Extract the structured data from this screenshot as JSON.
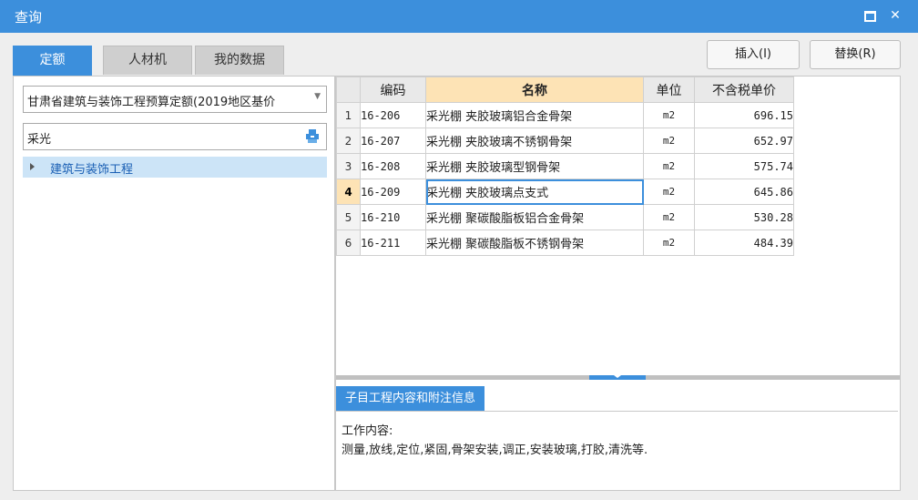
{
  "window": {
    "title": "查询"
  },
  "tabs": [
    {
      "label": "定额",
      "active": true
    },
    {
      "label": "人材机",
      "active": false
    },
    {
      "label": "我的数据",
      "active": false
    }
  ],
  "buttons": {
    "insert": "插入(I)",
    "replace": "替换(R)"
  },
  "left": {
    "selected_quota": "甘肃省建筑与装饰工程预算定额(2019地区基价",
    "search_value": "采光",
    "tree": [
      {
        "label": "建筑与装饰工程"
      }
    ]
  },
  "table": {
    "headers": [
      "编码",
      "名称",
      "单位",
      "不含税单价"
    ],
    "rows": [
      {
        "no": "1",
        "code": "16-206",
        "name": "采光棚 夹胶玻璃铝合金骨架",
        "unit": "m2",
        "price": "696.15"
      },
      {
        "no": "2",
        "code": "16-207",
        "name": "采光棚 夹胶玻璃不锈钢骨架",
        "unit": "m2",
        "price": "652.97"
      },
      {
        "no": "3",
        "code": "16-208",
        "name": "采光棚 夹胶玻璃型钢骨架",
        "unit": "m2",
        "price": "575.74"
      },
      {
        "no": "4",
        "code": "16-209",
        "name": "采光棚 夹胶玻璃点支式",
        "unit": "m2",
        "price": "645.86"
      },
      {
        "no": "5",
        "code": "16-210",
        "name": "采光棚 聚碳酸脂板铝合金骨架",
        "unit": "m2",
        "price": "530.28"
      },
      {
        "no": "6",
        "code": "16-211",
        "name": "采光棚 聚碳酸脂板不锈钢骨架",
        "unit": "m2",
        "price": "484.39"
      }
    ]
  },
  "info": {
    "tab_label": "子目工程内容和附注信息",
    "line1": "工作内容:",
    "line2": "测量,放线,定位,紧固,骨架安装,调正,安装玻璃,打胶,清洗等."
  },
  "colors": {
    "accent": "#3c8fdc",
    "highlight": "#fde3b5",
    "tree_selected": "#cce4f7"
  },
  "icons": {
    "maximize": "maximize-icon",
    "close": "close-icon",
    "search": "search-icon",
    "expand": "caret-right-icon"
  }
}
